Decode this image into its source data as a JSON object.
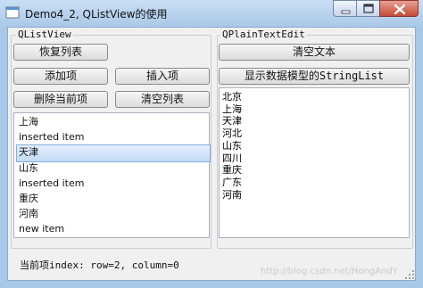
{
  "window": {
    "title": "Demo4_2, QListView的使用",
    "icon": "qt-app-icon",
    "controls": [
      "minimize-icon",
      "maximize-icon",
      "close-icon"
    ]
  },
  "left_panel": {
    "group_title": "QListView",
    "restore_list_label": "恢复列表",
    "add_item_label": "添加项",
    "insert_item_label": "插入项",
    "delete_item_label": "删除当前项",
    "clear_list_label": "清空列表",
    "list_items": [
      {
        "text": "上海",
        "selected": false
      },
      {
        "text": "inserted item",
        "selected": false
      },
      {
        "text": "天津",
        "selected": true
      },
      {
        "text": "山东",
        "selected": false
      },
      {
        "text": "inserted item",
        "selected": false
      },
      {
        "text": "重庆",
        "selected": false
      },
      {
        "text": "河南",
        "selected": false
      },
      {
        "text": "new item",
        "selected": false
      }
    ]
  },
  "right_panel": {
    "group_title": "QPlainTextEdit",
    "clear_text_label": "清空文本",
    "show_model_label": "显示数据模型的StringList",
    "text_lines": [
      "北京",
      "上海",
      "天津",
      "河北",
      "山东",
      "四川",
      "重庆",
      "广东",
      "河南"
    ]
  },
  "status_bar": {
    "text": "当前项index: row=2, column=0",
    "watermark": "http://blog.csdn.net/HongAndY"
  },
  "colors": {
    "frame": "#a9c8e8",
    "client": "#f0f0f0",
    "selection": "#c3dcf7",
    "close_button": "#c44a35"
  }
}
